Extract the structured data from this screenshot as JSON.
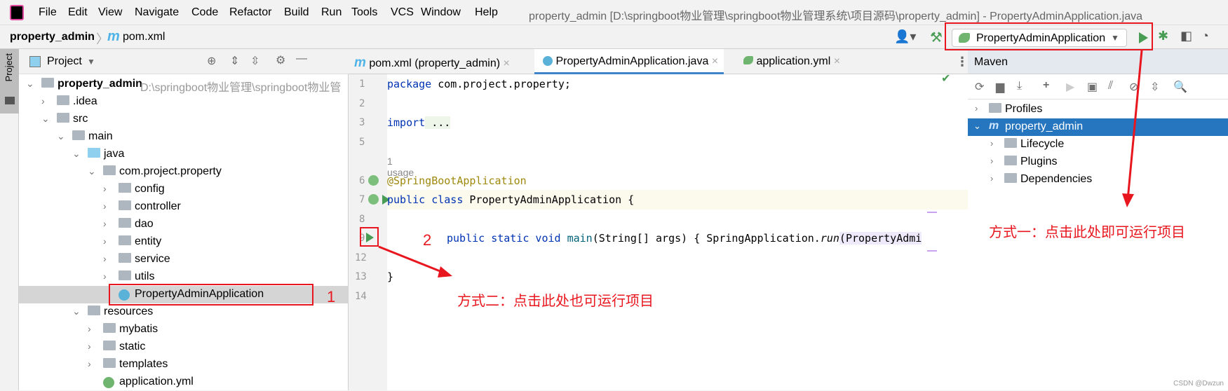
{
  "menubar": {
    "items": [
      "File",
      "Edit",
      "View",
      "Navigate",
      "Code",
      "Refactor",
      "Build",
      "Run",
      "Tools",
      "VCS",
      "Window",
      "Help"
    ],
    "title": "property_admin [D:\\springboot物业管理\\springboot物业管理系统\\项目源码\\property_admin] - PropertyAdminApplication.java"
  },
  "navbar": {
    "breadcrumb": [
      "property_admin",
      "pom.xml"
    ],
    "run_config": "PropertyAdminApplication"
  },
  "left_strip": {
    "label": "Project"
  },
  "project": {
    "header": "Project",
    "tree": [
      {
        "label": "property_admin",
        "path": "D:\\springboot物业管理\\springboot物业管",
        "depth": 0,
        "expanded": true,
        "bold": true
      },
      {
        "label": ".idea",
        "depth": 1,
        "expanded": false
      },
      {
        "label": "src",
        "depth": 1,
        "expanded": true
      },
      {
        "label": "main",
        "depth": 2,
        "expanded": true
      },
      {
        "label": "java",
        "depth": 3,
        "expanded": true
      },
      {
        "label": "com.project.property",
        "depth": 4,
        "expanded": true
      },
      {
        "label": "config",
        "depth": 5,
        "expanded": false
      },
      {
        "label": "controller",
        "depth": 5,
        "expanded": false
      },
      {
        "label": "dao",
        "depth": 5,
        "expanded": false
      },
      {
        "label": "entity",
        "depth": 5,
        "expanded": false
      },
      {
        "label": "service",
        "depth": 5,
        "expanded": false
      },
      {
        "label": "utils",
        "depth": 5,
        "expanded": false
      },
      {
        "label": "PropertyAdminApplication",
        "depth": 5,
        "selected": true,
        "leaf": true
      },
      {
        "label": "resources",
        "depth": 3,
        "expanded": true
      },
      {
        "label": "mybatis",
        "depth": 4,
        "expanded": false
      },
      {
        "label": "static",
        "depth": 4,
        "expanded": false
      },
      {
        "label": "templates",
        "depth": 4,
        "expanded": false
      },
      {
        "label": "application.yml",
        "depth": 4,
        "leaf": true
      }
    ]
  },
  "editor": {
    "tabs": [
      {
        "label": "pom.xml (property_admin)"
      },
      {
        "label": "PropertyAdminApplication.java",
        "active": true
      },
      {
        "label": "application.yml"
      }
    ],
    "line_numbers": [
      "1",
      "2",
      "3",
      "5",
      "",
      "6",
      "7",
      "8",
      "9",
      "12",
      "13",
      "14"
    ],
    "code": {
      "l1_kw": "package",
      "l1": " com.project.property;",
      "l3_kw": "import",
      "l3": " ...",
      "usage": "1 usage",
      "l6": "@SpringBootApplication",
      "l7_kw": "public class",
      "l7": " PropertyAdminApplication {",
      "l9_kw": "public static void",
      "l9_m": " main",
      "l9": "(String[] args) { SpringApplication.",
      "l9_run": "run",
      "l9_end": "(PropertyAdmi",
      "l13": "}"
    }
  },
  "maven": {
    "title": "Maven",
    "tree": [
      {
        "label": "Profiles"
      },
      {
        "label": "property_admin",
        "selected": true
      },
      {
        "label": "Lifecycle"
      },
      {
        "label": "Plugins"
      },
      {
        "label": "Dependencies"
      }
    ]
  },
  "annotations": {
    "n1": "1",
    "n2": "2",
    "way1": "方式一：点击此处即可运行项目",
    "way2": "方式二：点击此处也可运行项目"
  },
  "watermark": "CSDN @Dwzun",
  "colors": {
    "accent": "#2675bf",
    "annotation": "#e8161e",
    "run": "#499c54"
  }
}
